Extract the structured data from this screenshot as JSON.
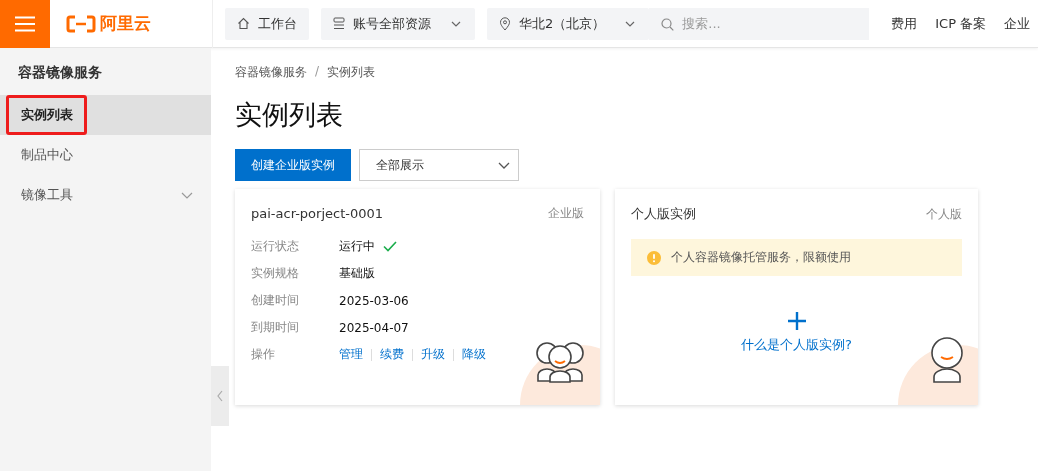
{
  "top_bar": {
    "logo": "阿里云",
    "nav": [
      {
        "kind": "home",
        "label": "工作台"
      },
      {
        "kind": "dropdown",
        "label": "账号全部资源"
      },
      {
        "kind": "location",
        "label": "华北2（北京）"
      }
    ],
    "search": {
      "placeholder": "搜索..."
    },
    "links": [
      "费用",
      "ICP 备案",
      "企业"
    ]
  },
  "sidebar": {
    "title": "容器镜像服务",
    "items": [
      {
        "label": "实例列表",
        "selected": true,
        "highlighted": true,
        "expandable": false
      },
      {
        "label": "制品中心",
        "selected": false,
        "highlighted": false,
        "expandable": false
      },
      {
        "label": "镜像工具",
        "selected": false,
        "highlighted": false,
        "expandable": true
      }
    ]
  },
  "breadcrumb": [
    "容器镜像服务",
    "实例列表"
  ],
  "breadcrumb_separator": "/",
  "page_title": "实例列表",
  "toolbar": {
    "create_button": "创建企业版实例",
    "filter": "全部展示"
  },
  "cards": [
    {
      "kind": "instance",
      "title": "pai-acr-porject-0001",
      "edition": "企业版",
      "fields": [
        {
          "label": "运行状态",
          "value": "运行中"
        },
        {
          "label": "实例规格",
          "value": "基础版"
        },
        {
          "label": "创建时间",
          "value": "2025-03-06"
        },
        {
          "label": "到期时间",
          "value": "2025-04-07"
        }
      ],
      "status_ok": true,
      "actions_label": "操作",
      "actions": [
        "管理",
        "续费",
        "升级",
        "降级"
      ]
    },
    {
      "kind": "personal",
      "title": "个人版实例",
      "edition": "个人版",
      "notice": "个人容器镜像托管服务，限额使用",
      "link": "什么是个人版实例?"
    }
  ]
}
